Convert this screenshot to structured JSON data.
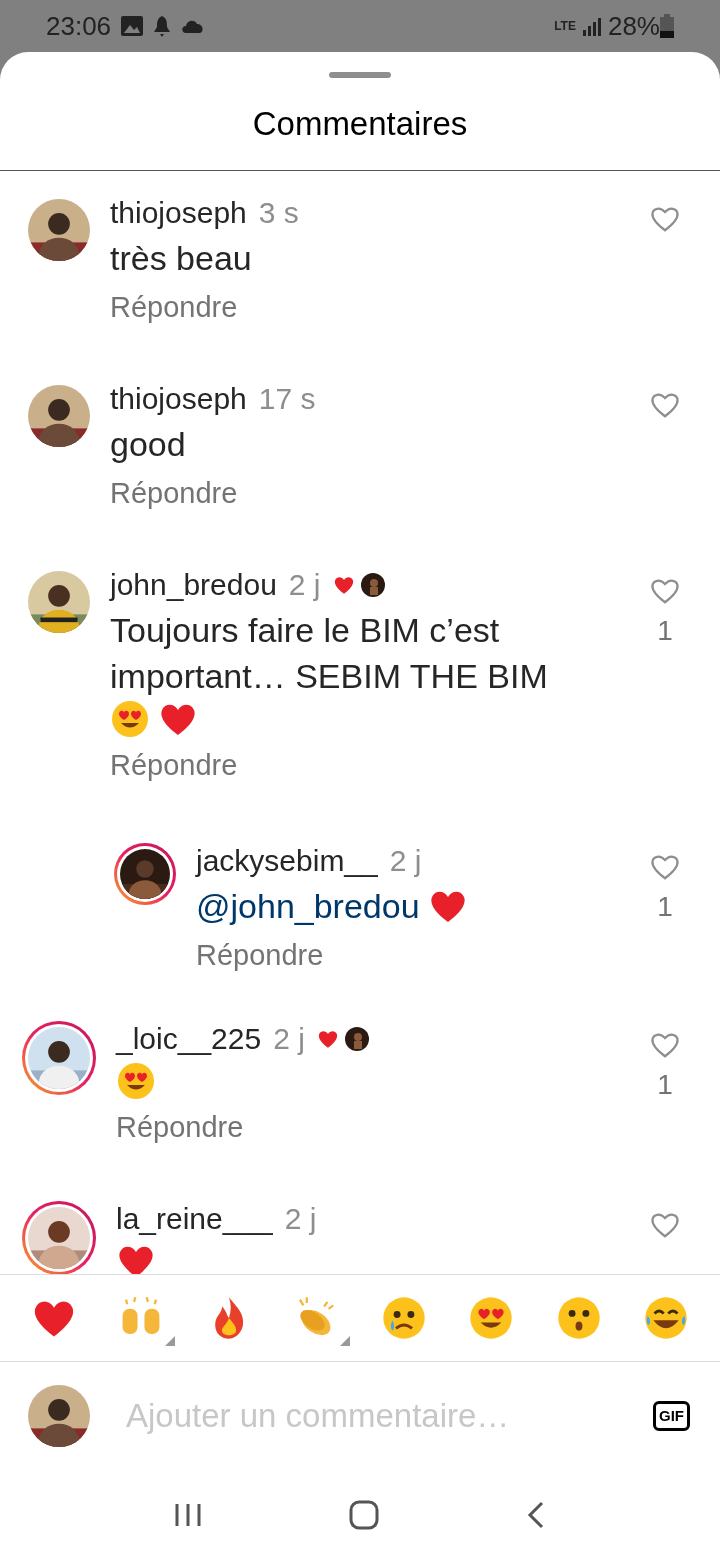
{
  "status_bar": {
    "time": "23:06",
    "network": "LTE",
    "battery": "28%"
  },
  "sheet": {
    "title": "Commentaires"
  },
  "comments": [
    {
      "username": "thiojoseph",
      "time": "3 s",
      "text": "très beau",
      "story_ring": false,
      "liked_by_author": false,
      "reply_label": "Répondre"
    },
    {
      "username": "thiojoseph",
      "time": "17 s",
      "text": "good",
      "story_ring": false,
      "liked_by_author": false,
      "reply_label": "Répondre"
    },
    {
      "username": "john_bredou",
      "time": "2 j",
      "text": "Toujours faire le BIM c’est important… SEBIM THE BIM",
      "emojis": [
        {
          "kind": "heart_eyes"
        },
        {
          "kind": "heart"
        }
      ],
      "story_ring": false,
      "liked_by_author": true,
      "likes": "1",
      "reply_label": "Répondre",
      "replies": [
        {
          "username": "jackysebim__",
          "time": "2 j",
          "mention": "@john_bredou",
          "emojis": [
            {
              "kind": "heart"
            }
          ],
          "story_ring": true,
          "liked_by_author": false,
          "likes": "1",
          "reply_label": "Répondre"
        }
      ]
    },
    {
      "username": "_loic__225",
      "time": "2 j",
      "emojis": [
        {
          "kind": "heart_eyes"
        }
      ],
      "story_ring": true,
      "liked_by_author": true,
      "likes": "1",
      "reply_label": "Répondre"
    },
    {
      "username": "la_reine___",
      "time": "2 j",
      "emojis": [
        {
          "kind": "heart"
        }
      ],
      "story_ring": true,
      "liked_by_author": false
    }
  ],
  "reactions": [
    {
      "kind": "heart",
      "has_variants": false
    },
    {
      "kind": "raised_hands",
      "has_variants": true
    },
    {
      "kind": "fire",
      "has_variants": false
    },
    {
      "kind": "clap",
      "has_variants": true
    },
    {
      "kind": "crying",
      "has_variants": false
    },
    {
      "kind": "heart_eyes",
      "has_variants": false
    },
    {
      "kind": "hushed",
      "has_variants": false
    },
    {
      "kind": "joy",
      "has_variants": false
    }
  ],
  "composer": {
    "placeholder": "Ajouter un commentaire…",
    "gif_label": "GIF"
  }
}
